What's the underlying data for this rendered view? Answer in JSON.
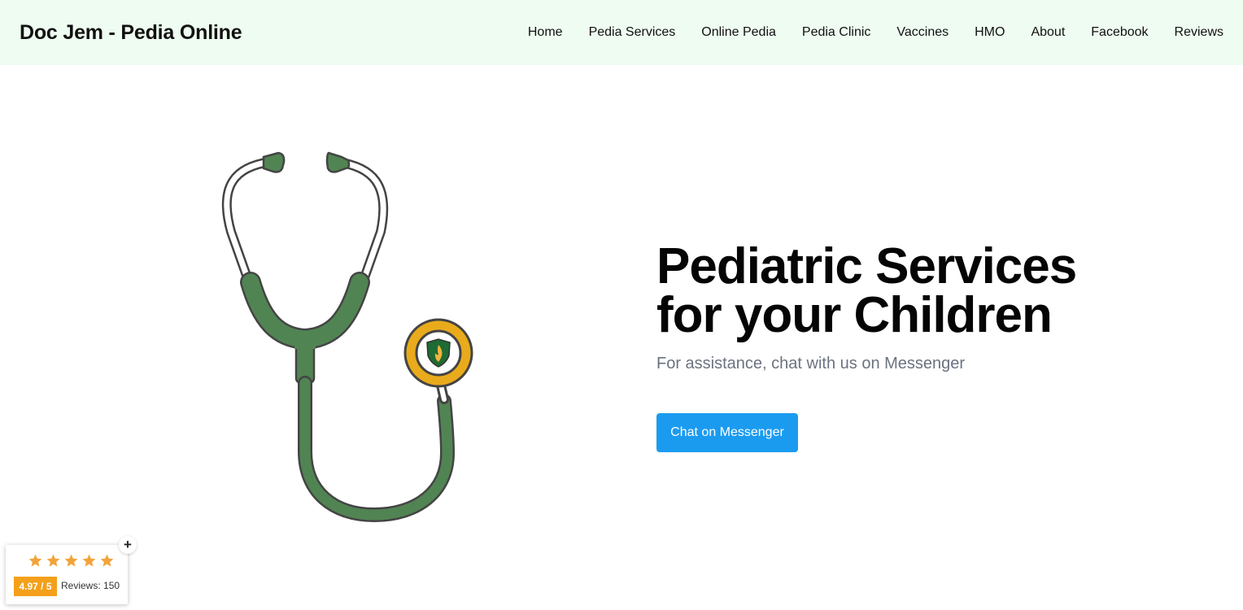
{
  "brand": {
    "name": "Doc Jem - Pedia Online"
  },
  "nav": {
    "items": [
      "Home",
      "Pedia Services",
      "Online Pedia",
      "Pedia Clinic",
      "Vaccines",
      "HMO",
      "About",
      "Facebook",
      "Reviews"
    ]
  },
  "hero": {
    "title_line1": "Pediatric Services",
    "title_line2": "for your Children",
    "subtitle": "For assistance, chat with us on Messenger",
    "cta_label": "Chat on Messenger",
    "illustration_icon": "stethoscope-icon"
  },
  "review_widget": {
    "stars": 5,
    "rating": "4.97 / 5",
    "reviews": "Reviews: 150",
    "toggle": "+"
  },
  "colors": {
    "header_bg": "#effcf1",
    "cta": "#1b9bf0",
    "badge": "#f4a01b",
    "stethoscope_green": "#518453",
    "chestpiece_gold": "#e9ab1b"
  }
}
